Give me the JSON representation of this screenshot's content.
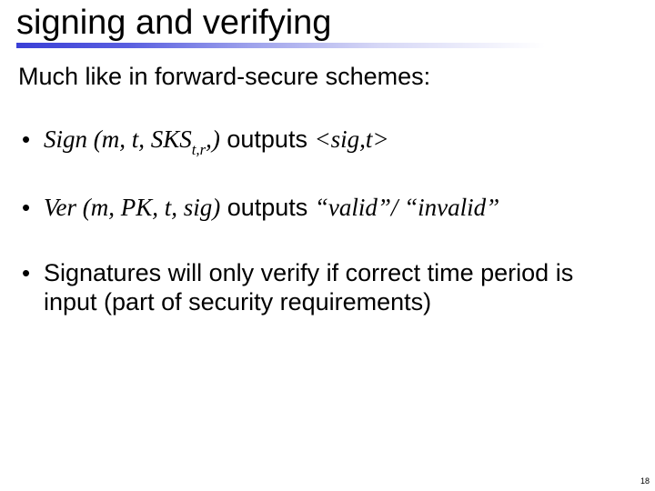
{
  "title": "signing and verifying",
  "lead": "Much like in forward-secure schemes:",
  "bullets": {
    "sign": {
      "fn": "Sign (m, t, SKS",
      "sub": "t,r",
      "after_sub": ",)",
      "outputs_word": " outputs ",
      "result": "<sig,t>"
    },
    "ver": {
      "fn": "Ver (m, PK, t, sig)",
      "outputs_word": " outputs ",
      "result": "“valid”/ “invalid”"
    },
    "note": "Signatures will only verify if correct time period is input (part of security requirements)"
  },
  "page_number": "18"
}
